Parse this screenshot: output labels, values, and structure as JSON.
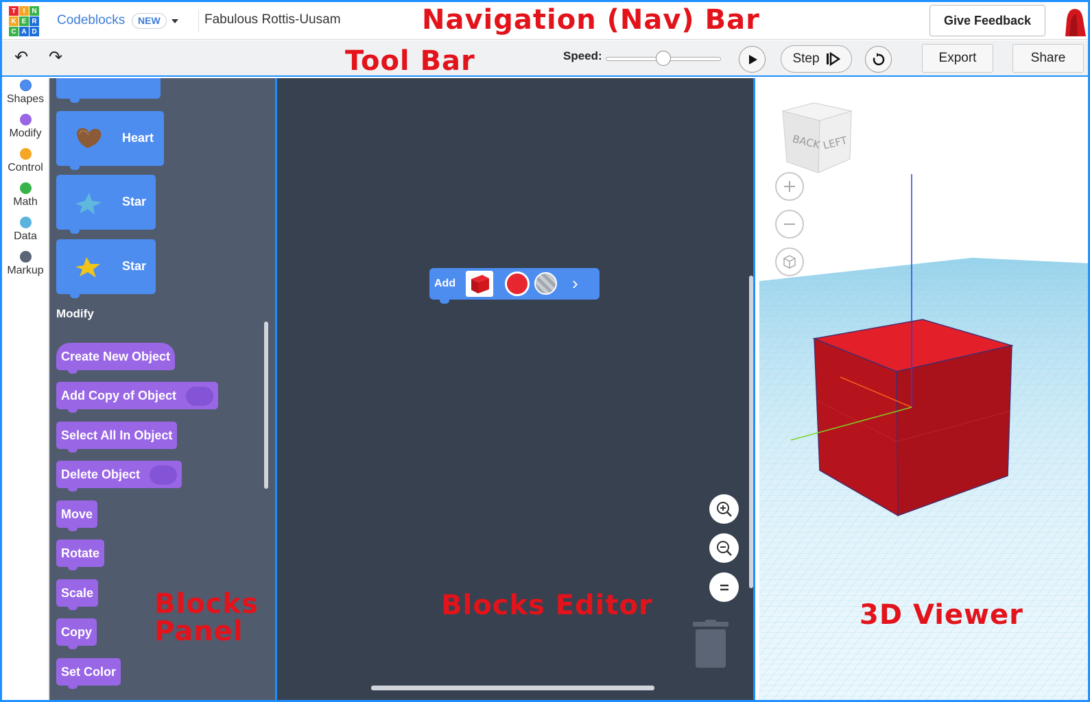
{
  "nav": {
    "logo_letters": [
      "T",
      "I",
      "N",
      "K",
      "E",
      "R",
      "C",
      "A",
      "D"
    ],
    "app_name": "Codeblocks",
    "new_badge": "NEW",
    "project_name": "Fabulous Rottis-Uusam",
    "feedback": "Give Feedback"
  },
  "annotations": {
    "nav": "Navigation (Nav) Bar",
    "toolbar": "Tool Bar",
    "panel_line1": "Blocks",
    "panel_line2": "Panel",
    "editor": "Blocks Editor",
    "viewer": "3D Viewer"
  },
  "toolbar": {
    "speed_label": "Speed:",
    "speed_value": 0.5,
    "step": "Step",
    "export": "Export",
    "share": "Share",
    "icons": [
      "undo-icon",
      "redo-icon",
      "play-icon",
      "step-icon",
      "reset-icon"
    ]
  },
  "categories": [
    {
      "label": "Shapes",
      "color": "#4d8df0"
    },
    {
      "label": "Modify",
      "color": "#9966e6"
    },
    {
      "label": "Control",
      "color": "#f5a623"
    },
    {
      "label": "Math",
      "color": "#38b349"
    },
    {
      "label": "Data",
      "color": "#5bb4e0"
    },
    {
      "label": "Markup",
      "color": "#5b6577"
    }
  ],
  "panel": {
    "shape_blocks": [
      {
        "label": "Heart",
        "icon": "heart-icon"
      },
      {
        "label": "Star",
        "icon": "star-icon"
      },
      {
        "label": "Star",
        "icon": "star-icon"
      }
    ],
    "modify_title": "Modify",
    "modify_blocks": [
      "Create New Object",
      "Add Copy of Object",
      "Select All In Object",
      "Delete Object",
      "Move",
      "Rotate",
      "Scale",
      "Copy",
      "Set Color"
    ]
  },
  "editor": {
    "add_block_label": "Add",
    "add_shape": "box",
    "add_color": "#e8262f"
  },
  "viewer": {
    "cube_labels": [
      "BACK",
      "LEFT"
    ],
    "object_color": "#d2161e"
  }
}
